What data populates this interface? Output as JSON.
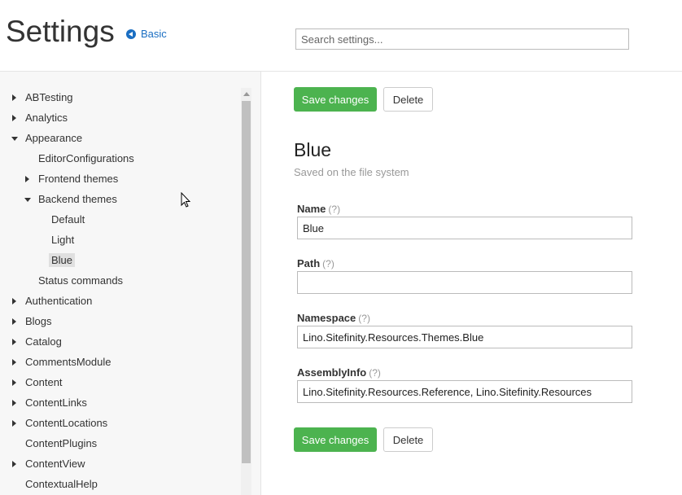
{
  "header": {
    "title": "Settings",
    "basic_link": "Basic",
    "search_placeholder": "Search settings..."
  },
  "sidebar": {
    "items": [
      {
        "label": "ABTesting",
        "state": "collapsed"
      },
      {
        "label": "Analytics",
        "state": "collapsed"
      },
      {
        "label": "Appearance",
        "state": "expanded"
      },
      {
        "label": "EditorConfigurations",
        "state": "leaf"
      },
      {
        "label": "Frontend themes",
        "state": "collapsed"
      },
      {
        "label": "Backend themes",
        "state": "expanded"
      },
      {
        "label": "Default",
        "state": "leaf"
      },
      {
        "label": "Light",
        "state": "leaf"
      },
      {
        "label": "Blue",
        "state": "leaf",
        "selected": true
      },
      {
        "label": "Status commands",
        "state": "leaf"
      },
      {
        "label": "Authentication",
        "state": "collapsed"
      },
      {
        "label": "Blogs",
        "state": "collapsed"
      },
      {
        "label": "Catalog",
        "state": "collapsed"
      },
      {
        "label": "CommentsModule",
        "state": "collapsed"
      },
      {
        "label": "Content",
        "state": "collapsed"
      },
      {
        "label": "ContentLinks",
        "state": "collapsed"
      },
      {
        "label": "ContentLocations",
        "state": "collapsed"
      },
      {
        "label": "ContentPlugins",
        "state": "leaf"
      },
      {
        "label": "ContentView",
        "state": "collapsed"
      },
      {
        "label": "ContextualHelp",
        "state": "leaf"
      }
    ]
  },
  "main": {
    "save_label": "Save changes",
    "delete_label": "Delete",
    "theme_title": "Blue",
    "theme_subtitle": "Saved on the file system",
    "help_marker": "(?)",
    "fields": [
      {
        "label": "Name",
        "value": "Blue"
      },
      {
        "label": "Path",
        "value": ""
      },
      {
        "label": "Namespace",
        "value": "Lino.Sitefinity.Resources.Themes.Blue"
      },
      {
        "label": "AssemblyInfo",
        "value": "Lino.Sitefinity.Resources.Reference, Lino.Sitefinity.Resources"
      }
    ]
  },
  "colors": {
    "accent_green": "#4cb34f",
    "link_blue": "#1a6ec2"
  }
}
